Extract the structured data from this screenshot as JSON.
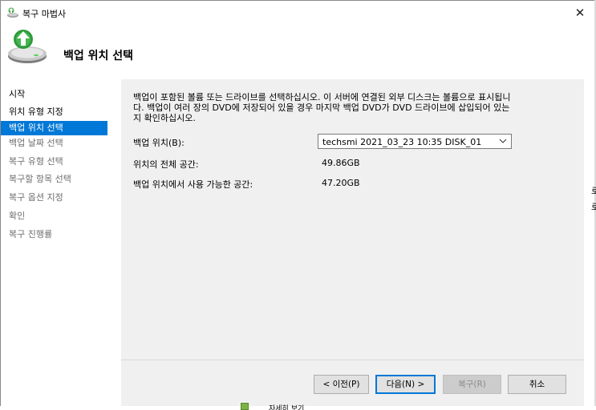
{
  "window": {
    "title": "복구 마법사",
    "close_glyph": "✕"
  },
  "header": {
    "title": "백업 위치 선택"
  },
  "nav": {
    "items": [
      {
        "label": "시작",
        "state": "normal"
      },
      {
        "label": "위치 유형 지정",
        "state": "normal"
      },
      {
        "label": "백업 위치 선택",
        "state": "active"
      },
      {
        "label": "백업 날짜 선택",
        "state": "disabled"
      },
      {
        "label": "복구 유형 선택",
        "state": "disabled"
      },
      {
        "label": "복구할 항목 선택",
        "state": "disabled"
      },
      {
        "label": "복구 옵션 지정",
        "state": "disabled"
      },
      {
        "label": "확인",
        "state": "disabled"
      },
      {
        "label": "복구 진행률",
        "state": "disabled"
      }
    ]
  },
  "main": {
    "description_lines": [
      "백업이 포함된 볼륨 또는 드라이브를 선택하십시오. 이 서버에 연결된 외부 디스크는 볼륨으로 표시됩니",
      "다. 백업이 여러 장의 DVD에 저장되어 있을 경우 마지막 백업 DVD가 DVD 드라이브에 삽입되어 있는",
      "지 확인하십시오."
    ],
    "backup_location_label": "백업 위치(B):",
    "backup_location_value": "techsmi 2021_03_23 10:35 DISK_01",
    "total_space_label": "위치의 전체 공간:",
    "total_space_value": "49.86GB",
    "free_space_label": "백업 위치에서 사용 가능한 공간:",
    "free_space_value": "47.20GB"
  },
  "buttons": {
    "previous": "< 이전(P)",
    "next": "다음(N) >",
    "recover": "복구(R)",
    "cancel": "취소"
  },
  "background": {
    "stub_1": "로",
    "stub_2": "로",
    "bottom_text": "자세히 보기"
  },
  "colors": {
    "accent": "#0078d7",
    "content_bg": "#f0f0f0"
  }
}
